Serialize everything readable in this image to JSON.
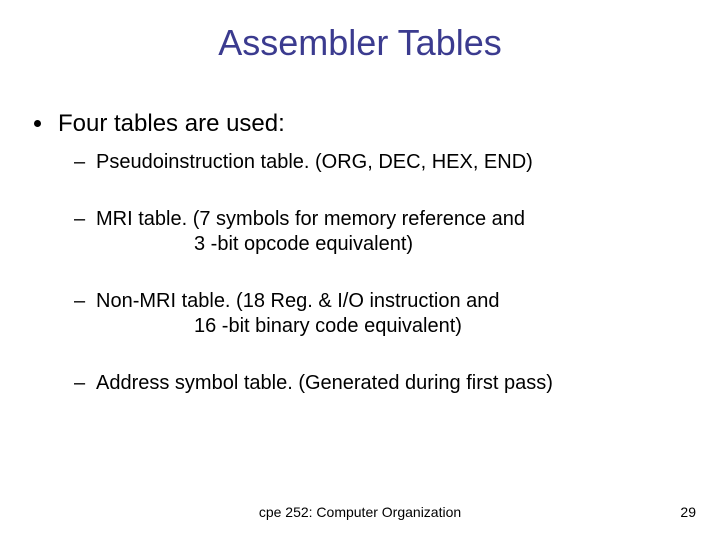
{
  "title": "Assembler Tables",
  "lead": "Four tables are used:",
  "items": [
    {
      "line1": "Pseudoinstruction table. (ORG, DEC, HEX, END)"
    },
    {
      "line1": "MRI table. (7 symbols for memory reference and",
      "line2": "3 -bit opcode equivalent)"
    },
    {
      "line1": "Non-MRI table. (18 Reg. & I/O instruction and",
      "line2": "16 -bit binary code equivalent)"
    },
    {
      "line1": "Address symbol table. (Generated during first pass)"
    }
  ],
  "footer": {
    "course": "cpe 252: Computer Organization",
    "page": "29"
  }
}
